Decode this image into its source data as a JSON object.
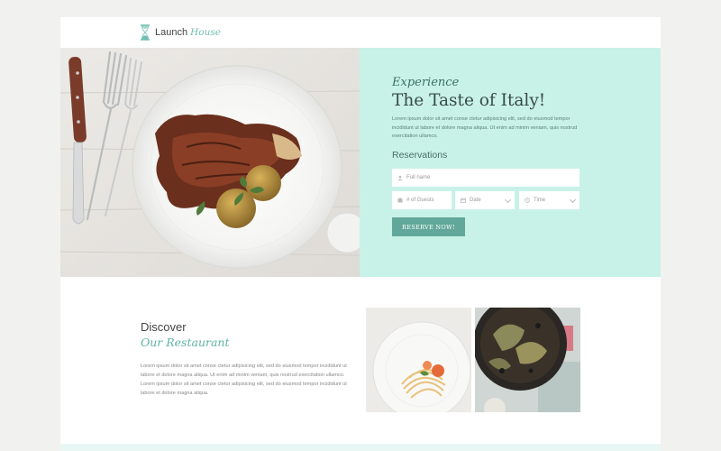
{
  "brand": {
    "name": "Launch",
    "accent": "House",
    "icon": "hourglass-icon"
  },
  "hero": {
    "kicker": "Experience",
    "title": "The Taste of Italy!",
    "lead": "Lorem ipsum dolor sit amet conse ctetur adipisicing elit, sed do eiusmod tempor incididunt ut labore et dolore magna aliqua. Ut enim ad minim veniam, quis nostrud exercitation ullamco.",
    "reservations_label": "Reservations",
    "fields": {
      "name_placeholder": "Full name",
      "guests_placeholder": "# of Guests",
      "date_placeholder": "Date",
      "time_placeholder": "Time"
    },
    "button_label": "RESERVE NOW!"
  },
  "discover": {
    "title": "Discover",
    "subtitle": "Our Restaurant",
    "text": "Lorem ipsum dolor sit amet conse ctetur adipisicing elit, sed do eiusmod tempor incididunt ut labore et dolore magna aliqua. Ut enim ad minim veniam, quis nostrud exercitation ullamco. Lorem ipsum dolor sit amet conse ctetur adipisicing elit, sed do eiusmod tempor incididunt ut labore et dolore magna aliqua."
  },
  "colors": {
    "accent": "#62a89a",
    "panel": "#c8f2e7",
    "accent_text": "#5fb3a4"
  }
}
